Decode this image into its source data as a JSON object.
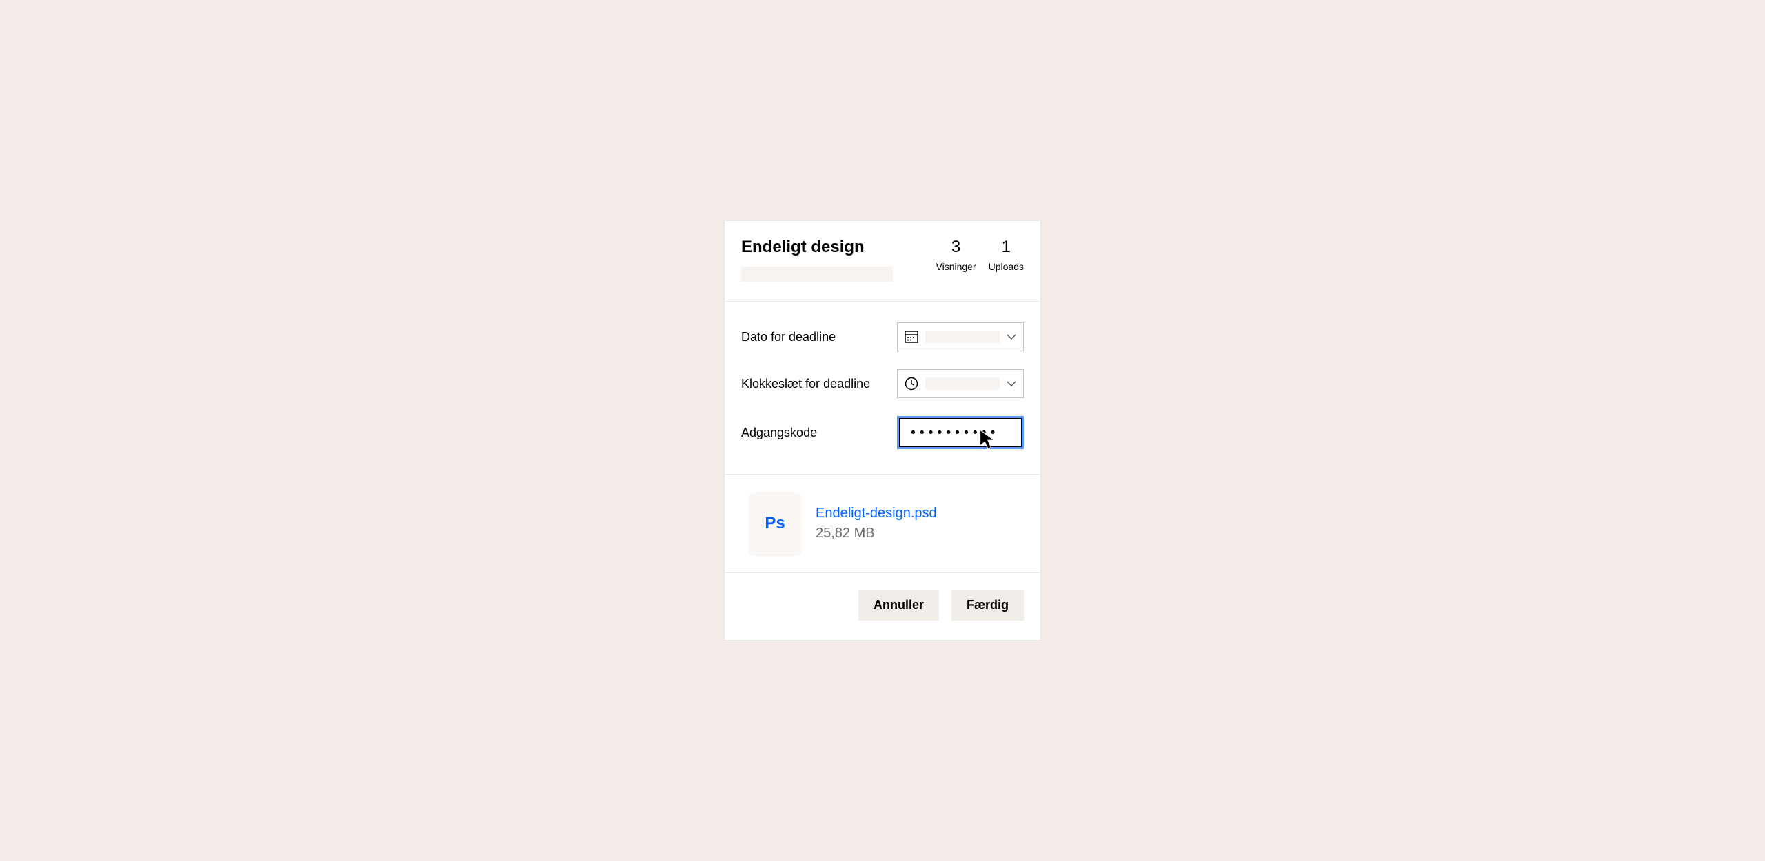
{
  "header": {
    "title": "Endeligt design"
  },
  "stats": {
    "views": {
      "value": "3",
      "label": "Visninger"
    },
    "uploads": {
      "value": "1",
      "label": "Uploads"
    }
  },
  "form": {
    "deadline_date_label": "Dato for deadline",
    "deadline_time_label": "Klokkeslæt for deadline",
    "password_label": "Adgangskode",
    "password_value": "••••••••••"
  },
  "file": {
    "icon_text": "Ps",
    "name": "Endeligt-design.psd",
    "size": "25,82 MB"
  },
  "buttons": {
    "cancel": "Annuller",
    "done": "Færdig"
  }
}
